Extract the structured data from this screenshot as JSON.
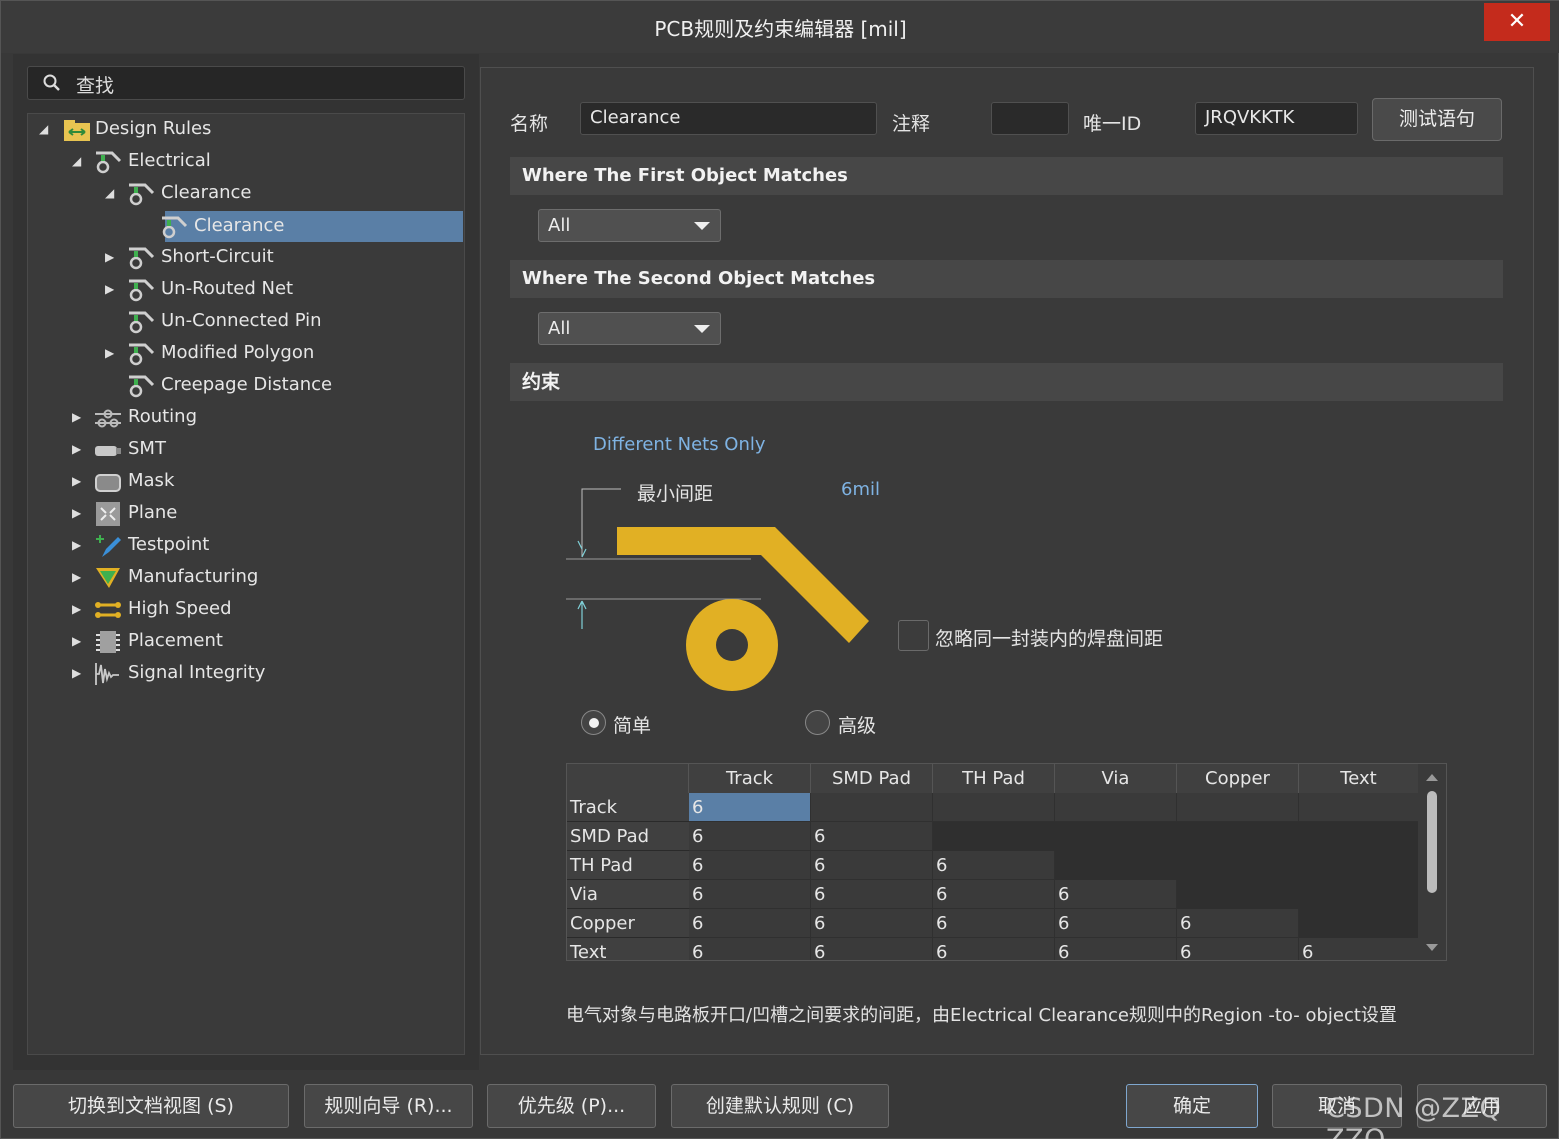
{
  "window": {
    "title": "PCB规则及约束编辑器 [mil]",
    "close_label": "✕"
  },
  "search": {
    "placeholder": "查找"
  },
  "tree": [
    {
      "label": "Design Rules"
    },
    {
      "label": "Electrical"
    },
    {
      "label": "Clearance"
    },
    {
      "label": "Clearance"
    },
    {
      "label": "Short-Circuit"
    },
    {
      "label": "Un-Routed Net"
    },
    {
      "label": "Un-Connected Pin"
    },
    {
      "label": "Modified Polygon"
    },
    {
      "label": "Creepage Distance"
    },
    {
      "label": "Routing"
    },
    {
      "label": "SMT"
    },
    {
      "label": "Mask"
    },
    {
      "label": "Plane"
    },
    {
      "label": "Testpoint"
    },
    {
      "label": "Manufacturing"
    },
    {
      "label": "High Speed"
    },
    {
      "label": "Placement"
    },
    {
      "label": "Signal Integrity"
    }
  ],
  "rule": {
    "name_label": "名称",
    "name_value": "Clearance",
    "comment_label": "注释",
    "comment_value": "",
    "uid_label": "唯一ID",
    "uid_value": "JRQVKKTK",
    "test_button": "测试语句"
  },
  "first_match": {
    "header": "Where The First Object Matches",
    "value": "All"
  },
  "second_match": {
    "header": "Where The Second Object Matches",
    "value": "All"
  },
  "constraints": {
    "header": "约束",
    "nets_label": "Different Nets Only",
    "min_clearance_label": "最小间距",
    "min_clearance_value": "6mil",
    "ignore_pads_label": "忽略同一封装内的焊盘间距",
    "ignore_pads_checked": false,
    "mode_simple": "简单",
    "mode_advanced": "高级",
    "mode_selected": "简单"
  },
  "grid": {
    "columns": [
      "Track",
      "SMD Pad",
      "TH Pad",
      "Via",
      "Copper",
      "Text"
    ],
    "rows": [
      {
        "name": "Track",
        "values": [
          "6"
        ]
      },
      {
        "name": "SMD Pad",
        "values": [
          "6",
          "6"
        ]
      },
      {
        "name": "TH Pad",
        "values": [
          "6",
          "6",
          "6"
        ]
      },
      {
        "name": "Via",
        "values": [
          "6",
          "6",
          "6",
          "6"
        ]
      },
      {
        "name": "Copper",
        "values": [
          "6",
          "6",
          "6",
          "6",
          "6"
        ]
      },
      {
        "name": "Text",
        "values": [
          "6",
          "6",
          "6",
          "6",
          "6",
          "6"
        ]
      }
    ]
  },
  "description": "电气对象与电路板开口/凹槽之间要求的间距，由Electrical Clearance规则中的Region -to- object设置",
  "buttons": {
    "switch_view": "切换到文档视图 (S)",
    "rule_wizard": "规则向导 (R)...",
    "priority": "优先级 (P)...",
    "create_default": "创建默认规则 (C)",
    "ok": "确定",
    "cancel": "取消",
    "apply": "应用"
  },
  "watermark": "CSDN @ZZQ ZZQ",
  "colors": {
    "accent": "#5a7fa6",
    "copper": "#e1b024",
    "link": "#7fb3e3"
  }
}
